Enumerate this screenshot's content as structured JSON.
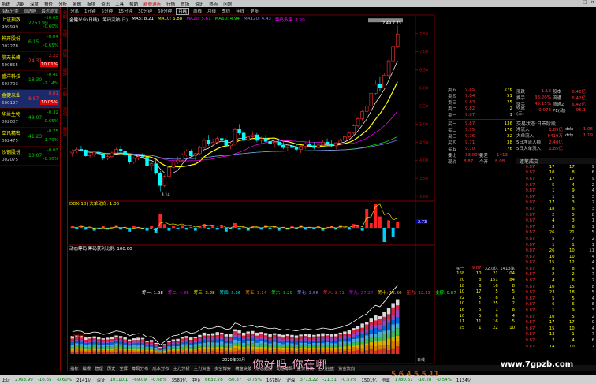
{
  "menu": {
    "items": [
      "系统",
      "功能",
      "深度",
      "报价",
      "分析",
      "金融",
      "板块",
      "资讯",
      "工具",
      "帮助"
    ],
    "highlight": "新费通点",
    "extra": [
      "行情",
      "市场",
      "资讯",
      "热点",
      "问题"
    ]
  },
  "left_list": {
    "headers": [
      "指标分类",
      "自选股",
      "最近浏览"
    ],
    "stocks": [
      {
        "name": "上证指数",
        "code": "999999",
        "price": "2763.99",
        "change": "-16.65",
        "pct": "-0.60%",
        "color": "#0c0",
        "selected": false
      },
      {
        "name": "神开股份",
        "code": "002278",
        "price": "6.15",
        "change": "-0.04",
        "pct": "-0.65%",
        "color": "#0c0",
        "selected": false
      },
      {
        "name": "航天长峰",
        "code": "600855",
        "price": "24.31",
        "change": "2.23",
        "pct": "10.01%",
        "color": "#f33",
        "selected": false,
        "pctbg": true
      },
      {
        "name": "盛洋科技",
        "code": "603703",
        "price": "18.30",
        "change": "-0.40",
        "pct": "-2.14%",
        "color": "#0c0",
        "selected": false
      },
      {
        "name": "金健米业",
        "code": "600127",
        "price": "8.87",
        "change": "0.81",
        "pct": "10.05%",
        "color": "#f33",
        "selected": true,
        "pctbg": true
      },
      {
        "name": "华兰生物",
        "code": "002007",
        "price": "49.07",
        "change": "-0.32",
        "pct": "-0.65%",
        "color": "#0c0",
        "selected": false
      },
      {
        "name": "立讯精密",
        "code": "002475",
        "price": "41.23",
        "change": "-0.75",
        "pct": "-1.79%",
        "color": "#0c0",
        "selected": false
      },
      {
        "name": "沙钢股份",
        "code": "002075",
        "price": "10.07",
        "change": "-0.03",
        "pct": "-0.30%",
        "color": "#0c0",
        "selected": false
      }
    ]
  },
  "side_tabs": [
    "分时",
    "K线",
    "自选",
    "板块",
    "个股",
    "资讯",
    "财务"
  ],
  "period_tabs": [
    "分笔",
    "1分钟",
    "5分钟",
    "15分钟",
    "30分钟",
    "60分钟",
    "日线",
    "周线",
    "月线",
    "季线",
    "年线",
    "更多"
  ],
  "active_period": "日线",
  "ma_legend": {
    "title": "金健米业(日线)",
    "label": "筹码突破(日)",
    "items": [
      {
        "t": "MA5: 8.21",
        "c": "#fff"
      },
      {
        "t": "MA10: 6.88",
        "c": "#ff0"
      },
      {
        "t": "MA20: 5.61",
        "c": "#f0f"
      },
      {
        "t": "MA60: 4.94",
        "c": "#0f0"
      },
      {
        "t": "MA120: 4.43",
        "c": "#88f"
      }
    ],
    "extra": "筹码多集: 7.20"
  },
  "price_labels": {
    "high": "7.49",
    "high2": "7.73",
    "low": "3.14"
  },
  "ind1_legend": {
    "text": "DDX(10) 大单动向: 1.06"
  },
  "ind2_legend": {
    "text": "动态筹码 筹码获利比例: 100.00",
    "row": [
      "筹一: 1.98",
      "筹二: 4.88",
      "筹三: 3.28",
      "筹四: 3.36",
      "筹五: 3.14",
      "筹六: 3.29",
      "筹七: 3.56",
      "筹八: 3.71",
      "筹九: 27.27",
      "筹十: 16.60",
      "压力: 32.13",
      "支撑: 9.87"
    ]
  },
  "chart_data": {
    "type": "candlestick",
    "title": "",
    "y_axis_ticks": [
      "7.50",
      "7.00",
      "6.50",
      "6.00",
      "5.50",
      "5.00",
      "4.50",
      "4.00",
      "3.50",
      "3.00"
    ],
    "ylim": [
      3.0,
      7.8
    ],
    "candles": [
      [
        4.2,
        4.3,
        4.1,
        4.25
      ],
      [
        4.25,
        4.35,
        4.2,
        4.3
      ],
      [
        4.3,
        4.4,
        4.25,
        4.28
      ],
      [
        4.28,
        4.3,
        4.1,
        4.12
      ],
      [
        4.12,
        4.2,
        4.05,
        4.15
      ],
      [
        4.15,
        4.25,
        4.1,
        4.22
      ],
      [
        4.22,
        4.3,
        4.15,
        4.18
      ],
      [
        4.18,
        4.2,
        4.0,
        4.05
      ],
      [
        4.05,
        4.15,
        4.0,
        4.1
      ],
      [
        4.1,
        4.25,
        4.05,
        4.2
      ],
      [
        4.2,
        4.35,
        4.18,
        4.3
      ],
      [
        4.3,
        4.4,
        4.2,
        4.25
      ],
      [
        4.25,
        4.3,
        4.1,
        4.15
      ],
      [
        4.15,
        4.2,
        3.9,
        3.95
      ],
      [
        3.95,
        4.1,
        3.9,
        4.05
      ],
      [
        4.05,
        4.15,
        4.0,
        4.1
      ],
      [
        4.1,
        4.2,
        4.05,
        4.08
      ],
      [
        4.08,
        4.1,
        3.8,
        3.85
      ],
      [
        3.85,
        3.95,
        3.7,
        3.9
      ],
      [
        3.9,
        4.0,
        3.6,
        3.65
      ],
      [
        3.65,
        3.7,
        3.14,
        3.3
      ],
      [
        3.3,
        3.6,
        3.25,
        3.55
      ],
      [
        3.55,
        3.85,
        3.5,
        3.8
      ],
      [
        3.8,
        4.0,
        3.75,
        3.95
      ],
      [
        3.95,
        4.1,
        3.9,
        4.0
      ],
      [
        4.0,
        4.2,
        3.95,
        4.15
      ],
      [
        4.15,
        4.3,
        4.1,
        4.25
      ],
      [
        4.25,
        4.3,
        4.1,
        4.12
      ],
      [
        4.12,
        4.2,
        4.0,
        4.18
      ],
      [
        4.18,
        4.4,
        4.15,
        4.35
      ],
      [
        4.35,
        4.6,
        4.3,
        4.55
      ],
      [
        4.55,
        4.7,
        4.4,
        4.45
      ],
      [
        4.45,
        4.6,
        4.35,
        4.5
      ],
      [
        4.5,
        4.65,
        4.45,
        4.6
      ],
      [
        4.6,
        4.8,
        4.5,
        4.55
      ],
      [
        4.55,
        4.6,
        4.35,
        4.4
      ],
      [
        4.4,
        4.5,
        4.3,
        4.45
      ],
      [
        4.45,
        4.9,
        4.4,
        4.85
      ],
      [
        4.85,
        5.0,
        4.7,
        4.75
      ],
      [
        4.75,
        4.8,
        4.5,
        4.55
      ],
      [
        4.55,
        4.7,
        4.45,
        4.65
      ],
      [
        4.65,
        4.8,
        4.6,
        4.7
      ],
      [
        4.7,
        4.75,
        4.5,
        4.55
      ],
      [
        4.55,
        4.65,
        4.45,
        4.6
      ],
      [
        4.6,
        4.7,
        4.5,
        4.52
      ],
      [
        4.52,
        4.6,
        4.4,
        4.45
      ],
      [
        4.45,
        4.55,
        4.35,
        4.5
      ],
      [
        4.5,
        4.6,
        4.4,
        4.42
      ],
      [
        4.42,
        4.5,
        4.3,
        4.35
      ],
      [
        4.35,
        4.45,
        4.25,
        4.4
      ],
      [
        4.4,
        4.5,
        4.3,
        4.35
      ],
      [
        4.35,
        4.45,
        4.25,
        4.3
      ],
      [
        4.3,
        4.4,
        4.2,
        4.38
      ],
      [
        4.38,
        4.5,
        4.3,
        4.45
      ],
      [
        4.45,
        4.55,
        4.35,
        4.4
      ],
      [
        4.4,
        4.5,
        4.3,
        4.35
      ],
      [
        4.35,
        4.45,
        4.3,
        4.42
      ],
      [
        4.42,
        4.55,
        4.4,
        4.5
      ],
      [
        4.5,
        4.6,
        4.4,
        4.45
      ],
      [
        4.45,
        4.55,
        4.35,
        4.4
      ],
      [
        4.4,
        4.5,
        4.3,
        4.48
      ],
      [
        4.48,
        4.6,
        4.45,
        4.55
      ],
      [
        4.55,
        4.7,
        4.5,
        4.65
      ],
      [
        4.65,
        4.8,
        4.6,
        4.75
      ],
      [
        4.75,
        5.0,
        4.7,
        4.95
      ],
      [
        4.95,
        5.2,
        4.9,
        5.15
      ],
      [
        5.15,
        5.4,
        5.1,
        5.35
      ],
      [
        5.35,
        5.6,
        5.3,
        5.5
      ],
      [
        5.5,
        5.9,
        5.45,
        5.85
      ],
      [
        5.85,
        6.2,
        5.8,
        6.1
      ],
      [
        6.1,
        6.3,
        5.9,
        6.0
      ],
      [
        6.0,
        6.4,
        5.95,
        6.35
      ],
      [
        6.35,
        6.8,
        6.3,
        6.75
      ],
      [
        6.75,
        7.2,
        6.7,
        7.15
      ],
      [
        7.15,
        7.73,
        7.1,
        7.49
      ]
    ],
    "ind1_bars": [
      0.2,
      -0.1,
      0.3,
      -0.2,
      0.1,
      -0.3,
      -0.1,
      0.2,
      -0.2,
      0.1,
      0.3,
      -0.2,
      0.1,
      -0.4,
      0.2,
      0.1,
      -0.1,
      -0.3,
      0.2,
      -0.5,
      1.5,
      0.4,
      -0.3,
      0.2,
      -0.1,
      0.3,
      -0.2,
      0.1,
      -0.3,
      0.2,
      0.4,
      -0.1,
      0.2,
      -0.2,
      0.3,
      -0.4,
      -0.1,
      0.5,
      -0.2,
      0.1,
      -0.3,
      0.2,
      0.1,
      -0.2,
      0.3,
      -0.1,
      0.2,
      -0.3,
      0.1,
      -0.2,
      0.2,
      -0.1,
      0.3,
      -0.2,
      0.1,
      -0.1,
      0.2,
      -0.3,
      0.1,
      0.2,
      -0.2,
      0.3,
      0.1,
      -0.2,
      0.4,
      0.2,
      -0.3,
      2.0,
      0.5,
      2.5,
      1.2,
      -1.5,
      0.8,
      -1.0,
      0.6
    ]
  },
  "quote_panel": {
    "sells": [
      [
        "卖五",
        "9.85",
        "276"
      ],
      [
        "卖四",
        "9.84",
        "51"
      ],
      [
        "卖三",
        "9.83",
        "25"
      ],
      [
        "卖二",
        "9.82",
        "2"
      ],
      [
        "卖一",
        "9.87",
        "1"
      ],
      [
        "买一",
        "9.87",
        "136"
      ],
      [
        "买二",
        "9.75",
        "176"
      ],
      [
        "买三",
        "9.76",
        "22"
      ],
      [
        "买四",
        "9.71",
        "38"
      ],
      [
        "买五",
        "9.70",
        "76"
      ]
    ],
    "summary": [
      [
        "委比",
        "-33.00%",
        "委差",
        "-1413"
      ],
      [
        "现价",
        "8.87",
        "今开",
        "8.08"
      ]
    ]
  },
  "info_panel": {
    "rows": [
      [
        "涨跌",
        "1.18",
        "股本",
        "6.42亿"
      ],
      [
        "换手",
        "38.20%",
        "流通",
        "6.42亿"
      ],
      [
        "涨手",
        "49.15%",
        "流通Z",
        "6.42亿"
      ],
      [
        "收益(三)",
        "0.078",
        "PE(动)",
        "95.1"
      ]
    ]
  },
  "fund_panel": {
    "title": "交易状态:日市阶段",
    "rows": [
      [
        "净流入",
        "1.85亿",
        "ddx",
        "1.06"
      ],
      [
        "大单流入",
        "9419万",
        "ddy",
        "1.19"
      ],
      [
        "5日净流入额",
        "2.40亿",
        "",
        ""
      ],
      [
        "5日大单流入",
        "1.85亿",
        "",
        ""
      ]
    ]
  },
  "trades": {
    "title": "逐笔成交",
    "rows": [
      [
        "9.87",
        "17",
        "17",
        "9"
      ],
      [
        "9.87",
        "10",
        "8",
        "6"
      ],
      [
        "9.87",
        "17",
        "17",
        "9"
      ],
      [
        "9.87",
        "5",
        "4",
        "2"
      ],
      [
        "9.87",
        "1",
        "9",
        "4"
      ],
      [
        "9.87",
        "1",
        "1",
        "3"
      ],
      [
        "9.87",
        "17",
        "3",
        "2"
      ],
      [
        "9.87",
        "18",
        "6",
        "3"
      ],
      [
        "9.87",
        "2",
        "5",
        "8"
      ],
      [
        "9.87",
        "4",
        "3",
        "1"
      ],
      [
        "9.87",
        "3",
        "6",
        "1"
      ],
      [
        "9.87",
        "26",
        "21",
        "5"
      ],
      [
        "9.87",
        "5",
        "7",
        "2"
      ],
      [
        "9.87",
        "1",
        "1",
        "1"
      ],
      [
        "9.87",
        "26",
        "10",
        "11"
      ],
      [
        "9.87",
        "10",
        "10",
        "4"
      ],
      [
        "9.87",
        "15",
        "12",
        "4"
      ],
      [
        "9.87",
        "8",
        "8",
        "4"
      ],
      [
        "9.87",
        "2",
        "2",
        "7"
      ],
      [
        "9.87",
        "4",
        "6",
        "2"
      ],
      [
        "9.87",
        "10",
        "15",
        "8"
      ],
      [
        "9.87",
        "23",
        "18",
        "5"
      ],
      [
        "9.87",
        "5",
        "5",
        "4"
      ],
      [
        "9.87",
        "6",
        "6",
        "8"
      ],
      [
        "9.87",
        "1",
        "9",
        "3"
      ],
      [
        "9.87",
        "10",
        "5",
        "2"
      ],
      [
        "9.87",
        "17",
        "17",
        "9"
      ],
      [
        "9.87",
        "15",
        "10",
        "4"
      ],
      [
        "9.87",
        "13",
        "1",
        "7"
      ],
      [
        "9.87",
        "2",
        "4",
        "6"
      ],
      [
        "9.87",
        "14",
        "10",
        "2"
      ]
    ]
  },
  "book2": {
    "head": [
      "买一",
      "9.87",
      "32.0亿",
      "1413笔"
    ],
    "rows": [
      [
        "168",
        "10",
        "21",
        "104"
      ],
      [
        "20",
        "8",
        "151",
        "84"
      ],
      [
        "18",
        "6",
        "16",
        "8"
      ],
      [
        "10",
        "17",
        "5",
        "5"
      ],
      [
        "22",
        "5",
        "8",
        "1"
      ],
      [
        "10",
        "1",
        "25",
        "2"
      ],
      [
        "16",
        "5",
        "1",
        "8"
      ],
      [
        "10",
        "5",
        "6",
        "4"
      ],
      [
        "11",
        "11",
        "16",
        "5"
      ],
      [
        "25",
        "1",
        "22",
        "10"
      ]
    ]
  },
  "bottom_tabs": [
    "指标",
    "模板",
    "管理",
    "历史",
    "全屏",
    "筹码分布",
    "成本分布",
    "主力分析",
    "主力资金",
    "多空博弈",
    "横盘突破",
    "形态选股",
    "动态筹码",
    "量价背离",
    "主力控盘",
    "资金流向"
  ],
  "status": [
    {
      "t": "上证",
      "c": ""
    },
    {
      "t": "2763.99",
      "c": "dn"
    },
    {
      "t": "-16.65",
      "c": "dn"
    },
    {
      "t": "-0.60%",
      "c": "dn"
    },
    {
      "t": "2141亿",
      "c": ""
    },
    {
      "t": "深证",
      "c": ""
    },
    {
      "t": "10110.1",
      "c": "dn"
    },
    {
      "t": "-69.09",
      "c": "dn"
    },
    {
      "t": "-0.68%",
      "c": "dn"
    },
    {
      "t": "3583亿",
      "c": ""
    },
    {
      "t": "中小",
      "c": ""
    },
    {
      "t": "6632.78",
      "c": "dn"
    },
    {
      "t": "-50.37",
      "c": "dn"
    },
    {
      "t": "-0.75%",
      "c": "dn"
    },
    {
      "t": "1678亿",
      "c": ""
    },
    {
      "t": "沪深",
      "c": ""
    },
    {
      "t": "3713.22",
      "c": "dn"
    },
    {
      "t": "-21.31",
      "c": "dn"
    },
    {
      "t": "-0.57%",
      "c": "dn"
    },
    {
      "t": "1501亿",
      "c": ""
    },
    {
      "t": "创业",
      "c": ""
    },
    {
      "t": "1780.67",
      "c": "dn"
    },
    {
      "t": "-10.28",
      "c": "dn"
    },
    {
      "t": "-0.54%",
      "c": "dn"
    },
    {
      "t": "1134亿",
      "c": ""
    }
  ],
  "overlay_text": "你好吗  你在哪",
  "watermark": "www.7gpzb.com",
  "bottom_logo": "5.6.4 5.5.11",
  "x_axis": {
    "left": "2020年",
    "mid": "2020年03月",
    "right": "日线"
  },
  "indicator_axis": {
    "top": "2.73"
  }
}
